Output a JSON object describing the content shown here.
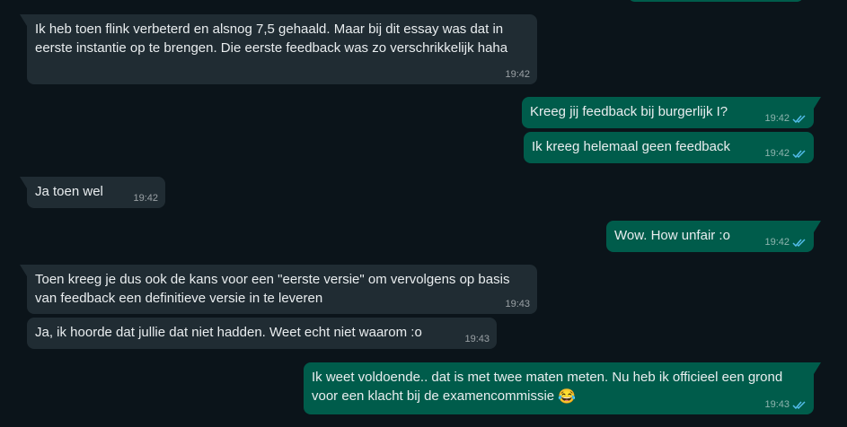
{
  "messages": [
    {
      "id": "m1",
      "direction": "in",
      "text": "Ik heb toen flink verbeterd en alsnog 7,5 gehaald. Maar bij dit essay was dat in\neerste instantie op te brengen. Die eerste feedback was zo verschrikkelijk haha",
      "time": "19:42"
    },
    {
      "id": "m2",
      "direction": "out",
      "text": "Kreeg jij feedback bij burgerlijk I?",
      "time": "19:42",
      "status": "read"
    },
    {
      "id": "m3",
      "direction": "out",
      "text": "Ik kreeg helemaal geen feedback",
      "time": "19:42",
      "status": "read"
    },
    {
      "id": "m4",
      "direction": "in",
      "text": "Ja toen wel",
      "time": "19:42"
    },
    {
      "id": "m5",
      "direction": "out",
      "text": "Wow. How unfair :o",
      "time": "19:42",
      "status": "read"
    },
    {
      "id": "m6",
      "direction": "in",
      "text": "Toen kreeg je dus ook de kans voor een \"eerste versie\" om vervolgens op basis\nvan feedback een definitieve versie in te leveren",
      "time": "19:43"
    },
    {
      "id": "m7",
      "direction": "in",
      "text": "Ja, ik hoorde dat jullie dat niet hadden. Weet echt niet waarom :o",
      "time": "19:43"
    },
    {
      "id": "m8",
      "direction": "out",
      "text": "Ik weet voldoende.. dat is met twee maten meten. Nu heb ik officieel een grond\nvoor een klacht bij de examencommissie ",
      "emoji": "😂",
      "time": "19:43",
      "status": "read"
    }
  ],
  "colors": {
    "background": "#0b141a",
    "incoming_bubble": "#202c33",
    "outgoing_bubble": "#005c4b",
    "text": "#e9edef",
    "read_ticks": "#53bdeb"
  },
  "icons": {
    "read_status": "double-check-icon"
  }
}
